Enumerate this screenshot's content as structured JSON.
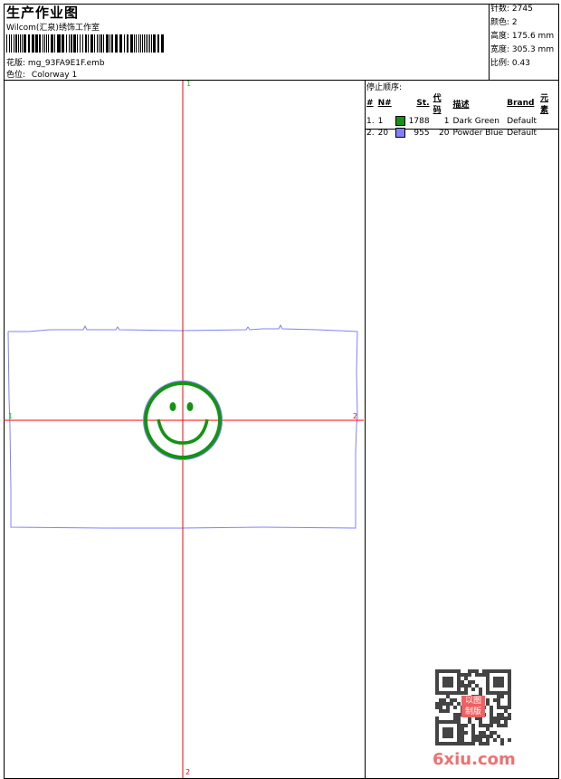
{
  "header": {
    "title": "生产作业图",
    "studio": "Wilcom(汇泉)绣饰工作室",
    "design_label": "花版:",
    "design_file": "mg_93FA9E1F.emb",
    "colorway_label": "色位:",
    "colorway": "Colorway 1"
  },
  "info": [
    {
      "label": "针数:",
      "value": "2745"
    },
    {
      "label": "颜色:",
      "value": "2"
    },
    {
      "label": "高度:",
      "value": "175.6 mm"
    },
    {
      "label": "宽度:",
      "value": "305.3 mm"
    },
    {
      "label": "比例:",
      "value": "0.43"
    }
  ],
  "stop_sequence": {
    "title": "停止顺序:",
    "columns": [
      "#",
      "N#",
      "St.",
      "代码",
      "描述",
      "Brand",
      "元素"
    ],
    "rows": [
      {
        "idx": "1.",
        "n": "1",
        "color": "#129412",
        "st": "1788",
        "code": "1",
        "desc": "Dark Green",
        "brand": "Default",
        "element": ""
      },
      {
        "idx": "2.",
        "n": "20",
        "color": "#8080ff",
        "st": "955",
        "code": "20",
        "desc": "Powder Blue",
        "brand": "Default",
        "element": ""
      }
    ]
  },
  "canvas": {
    "markers": {
      "top": "1",
      "bottom": "2",
      "left": "1",
      "right": "2"
    },
    "colors": {
      "crosshair": "#ff0000",
      "start": "#00e000",
      "end": "#ff0000",
      "outline": "#8080ff",
      "smiley": "#129412"
    }
  },
  "watermark": {
    "text": "6xiu.com",
    "seal": "以图制版"
  }
}
